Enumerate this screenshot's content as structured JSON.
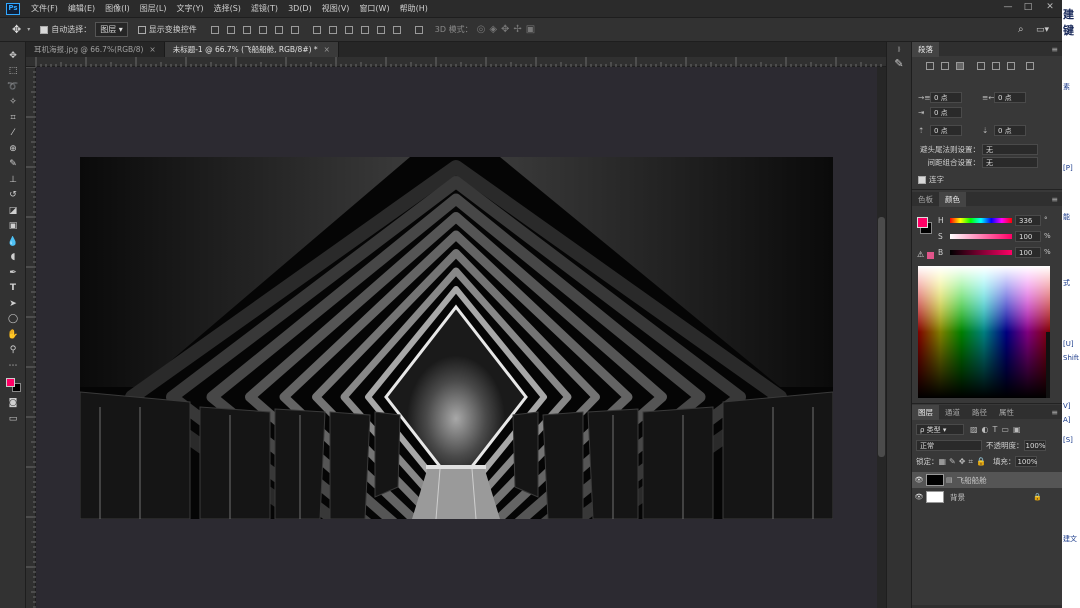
{
  "menu": [
    "文件(F)",
    "编辑(E)",
    "图像(I)",
    "图层(L)",
    "文字(Y)",
    "选择(S)",
    "滤镜(T)",
    "3D(D)",
    "视图(V)",
    "窗口(W)",
    "帮助(H)"
  ],
  "logo": "Ps",
  "window_controls": [
    "—",
    "□",
    "✕"
  ],
  "options": {
    "auto_select_label": "自动选择：",
    "auto_select_value": "图层",
    "show_transform_label": "显示变换控件",
    "mode_3d_label": "3D 模式："
  },
  "tabs": [
    {
      "label": "耳机海报.jpg @ 66.7%(RGB/8)",
      "close": "×"
    },
    {
      "label": "未标题-1 @ 66.7% (飞船船舱, RGB/8#) *",
      "close": "×"
    }
  ],
  "paragraph_panel": {
    "title": "段落",
    "indent_left": "0 点",
    "indent_right": "0 点",
    "indent_first": "0 点",
    "space_before": "0 点",
    "space_after": "0 点",
    "kinsoku_label": "避头尾法则设置：",
    "kinsoku_value": "无",
    "spacing_label": "间距组合设置：",
    "spacing_value": "无",
    "hyphen_label": "连字"
  },
  "color_panel": {
    "tabs": [
      "色板",
      "颜色"
    ],
    "h_label": "H",
    "h_value": "336",
    "h_unit": "°",
    "s_label": "S",
    "s_value": "100",
    "s_unit": "%",
    "b_label": "B",
    "b_value": "100",
    "b_unit": "%",
    "foreground": "#ff0066",
    "background": "#000000"
  },
  "layers_panel": {
    "tabs": [
      "图层",
      "通道",
      "路径",
      "属性"
    ],
    "filter_label": "ρ 类型",
    "blend_mode": "正常",
    "opacity_label": "不透明度：",
    "opacity_value": "100%",
    "lock_label": "锁定：",
    "fill_label": "填充：",
    "fill_value": "100%",
    "layers": [
      {
        "name": "飞船船舱",
        "selected": true
      },
      {
        "name": "背景",
        "selected": false
      }
    ]
  },
  "edge_text": [
    "建键",
    "素",
    "[P]",
    "能",
    "[U]",
    "V]",
    "A]",
    "[S]",
    "Shift",
    "建文",
    "式"
  ]
}
